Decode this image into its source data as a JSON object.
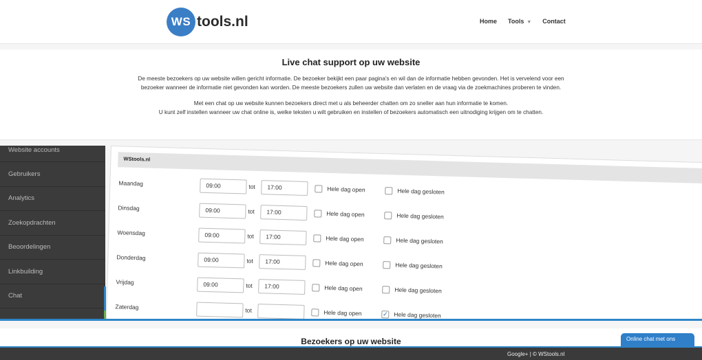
{
  "header": {
    "logo_badge": "WS",
    "logo_text": "tools.nl",
    "nav": {
      "home": "Home",
      "tools": "Tools",
      "contact": "Contact"
    }
  },
  "intro": {
    "title": "Live chat support op uw website",
    "p1": "De meeste bezoekers op uw website willen gericht informatie. De bezoeker bekijkt een paar pagina's en wil dan de informatie hebben gevonden. Het is vervelend voor een bezoeker wanneer de informatie niet gevonden kan worden. De meeste bezoekers zullen uw website dan verlaten en de vraag via de zoekmachines proberen te vinden.",
    "p2a": "Met een chat op uw website kunnen bezoekers direct met u als beheerder chatten om zo sneller aan hun informatie te komen.",
    "p2b": "U kunt zelf instellen wanneer uw chat online is, welke teksten u wilt gebruiken en instellen of bezoekers automatisch een uitnodiging krijgen om te chatten."
  },
  "sidebar": {
    "items": [
      {
        "label": "Website accounts"
      },
      {
        "label": "Gebruikers"
      },
      {
        "label": "Analytics"
      },
      {
        "label": "Zoekopdrachten"
      },
      {
        "label": "Beoordelingen"
      },
      {
        "label": "Linkbuilding"
      },
      {
        "label": "Chat"
      }
    ]
  },
  "panel": {
    "title": "WStools.nl",
    "to_label": "tot",
    "open_label": "Hele dag open",
    "closed_label": "Hele dag gesloten",
    "days": [
      {
        "day": "Maandag",
        "from": "09:00",
        "to": "17:00",
        "open": false,
        "closed": false
      },
      {
        "day": "Dinsdag",
        "from": "09:00",
        "to": "17:00",
        "open": false,
        "closed": false
      },
      {
        "day": "Woensdag",
        "from": "09:00",
        "to": "17:00",
        "open": false,
        "closed": false
      },
      {
        "day": "Donderdag",
        "from": "09:00",
        "to": "17:00",
        "open": false,
        "closed": false
      },
      {
        "day": "Vrijdag",
        "from": "09:00",
        "to": "17:00",
        "open": false,
        "closed": false
      },
      {
        "day": "Zaterdag",
        "from": "",
        "to": "",
        "open": false,
        "closed": true
      }
    ]
  },
  "bottom": {
    "title": "Bezoekers op uw website"
  },
  "footer": {
    "text": "Google+ | © WStools.nl"
  },
  "chat_button": {
    "label": "Online chat met ons"
  },
  "colors": {
    "accent": "#2f86c8",
    "sidebar": "#3b3b3b"
  }
}
